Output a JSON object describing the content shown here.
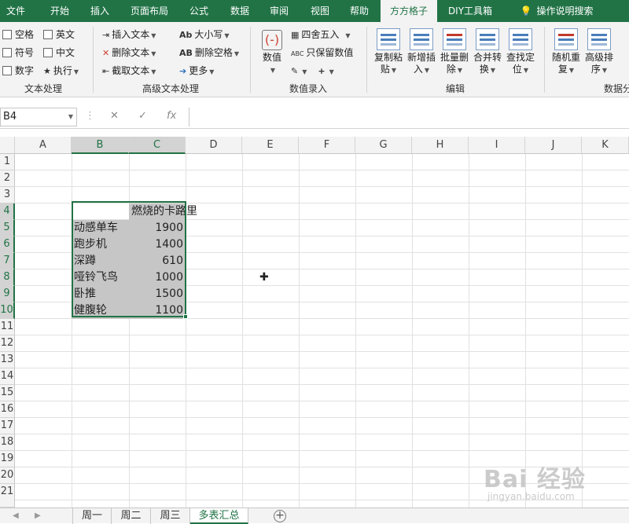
{
  "tabs": [
    {
      "label": "文件"
    },
    {
      "label": "开始"
    },
    {
      "label": "插入"
    },
    {
      "label": "页面布局"
    },
    {
      "label": "公式"
    },
    {
      "label": "数据"
    },
    {
      "label": "审阅"
    },
    {
      "label": "视图"
    },
    {
      "label": "帮助"
    },
    {
      "label": "方方格子",
      "active": true
    },
    {
      "label": "DIY工具箱"
    },
    {
      "label": "操作说明搜索"
    }
  ],
  "ribbon": {
    "text_processing": {
      "items": [
        "空格",
        "英文",
        "符号",
        "中文",
        "数字",
        "执行"
      ],
      "label": "文本处理"
    },
    "advanced_text": {
      "items": [
        "插入文本",
        "删除文本",
        "截取文本",
        "大小写",
        "删除空格",
        "更多"
      ],
      "label": "高级文本处理"
    },
    "number_entry": {
      "value_btn": "数值",
      "round": "四舍五入",
      "keep_value": "只保留数值",
      "label": "数值录入"
    },
    "edit": {
      "buttons": [
        {
          "l1": "复制粘",
          "l2": "贴"
        },
        {
          "l1": "新增插",
          "l2": "入"
        },
        {
          "l1": "批量删",
          "l2": "除"
        },
        {
          "l1": "合并转",
          "l2": "换"
        },
        {
          "l1": "查找定",
          "l2": "位"
        }
      ],
      "label": "编辑"
    },
    "data_analysis": {
      "buttons": [
        {
          "l1": "随机重",
          "l2": "复"
        },
        {
          "l1": "高级排",
          "l2": "序"
        }
      ],
      "label": "数据分"
    }
  },
  "formula_bar": {
    "name_box": "B4",
    "value": ""
  },
  "columns": [
    "A",
    "B",
    "C",
    "D",
    "E",
    "F",
    "G",
    "H",
    "I",
    "J",
    "K"
  ],
  "rows": [
    "1",
    "2",
    "3",
    "4",
    "5",
    "6",
    "7",
    "8",
    "9",
    "10",
    "11",
    "12",
    "13",
    "14",
    "15",
    "16",
    "17",
    "18",
    "19",
    "20",
    "21"
  ],
  "table": {
    "header": "燃烧的卡路里",
    "rows": [
      {
        "label": "动感单车",
        "value": "1900"
      },
      {
        "label": "跑步机",
        "value": "1400"
      },
      {
        "label": "深蹲",
        "value": "610"
      },
      {
        "label": "哑铃飞鸟",
        "value": "1000"
      },
      {
        "label": "卧推",
        "value": "1500"
      },
      {
        "label": "健腹轮",
        "value": "1100"
      }
    ]
  },
  "sheets": [
    {
      "name": "周一"
    },
    {
      "name": "周二"
    },
    {
      "name": "周三"
    },
    {
      "name": "多表汇总",
      "active": true
    }
  ],
  "watermark": {
    "main": "Bai 经验",
    "sub": "jingyan.baidu.com"
  },
  "colors": {
    "accent": "#217346",
    "selection": "#c6c6c6"
  }
}
